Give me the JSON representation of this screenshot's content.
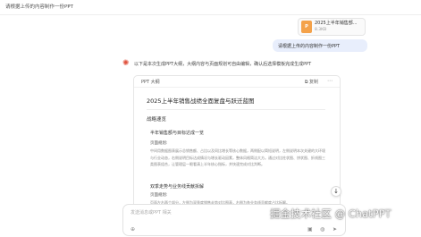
{
  "header": {
    "title": "请根据上传的内容制作一份PPT"
  },
  "upload": {
    "file_name": "2025上半年销售部...",
    "file_size": "8.3KB",
    "file_type": "PPT"
  },
  "user_message": "请根据上传的内容制作一份PPT",
  "assistant": {
    "intro": "以下是本次生成PPT大纲，大纲内容与页面规划可自由编辑，确认后选择模板完成生成PPT",
    "panel": {
      "title": "PPT 大纲",
      "copy_label": "复制",
      "doc_title": "2025上半年销售战绩全面复盘与跃迁蓝图",
      "section1": "战略速览",
      "subsection1": "半年销售额与目标达成一览",
      "page_label1": "页面规划:",
      "para1": "中间用数据图表展示总销售额、占比以及同比增长等核心数据，两侧配以简短说明，左侧说明本次关键的大环境与行业动态，右侧说明目标达成情况与增长驱动因素，整体风格简洁大方。通过对比柱状图、饼状图、折线图三类图表组合，让管理层一眼看清上半年核心指标，并快速完成对比判断。",
      "subsection2": "双季走势与业务线贡献拆解",
      "page_label2": "页面规划:",
      "para2": "页面左右两个部分，左侧为双季度销售走势对比图表，右侧为各业务线贡献度占比拆解。"
    }
  },
  "input": {
    "placeholder": "发送消息或PPT 相关"
  },
  "watermark": "掘金技术社区 @ ChatPPT"
}
